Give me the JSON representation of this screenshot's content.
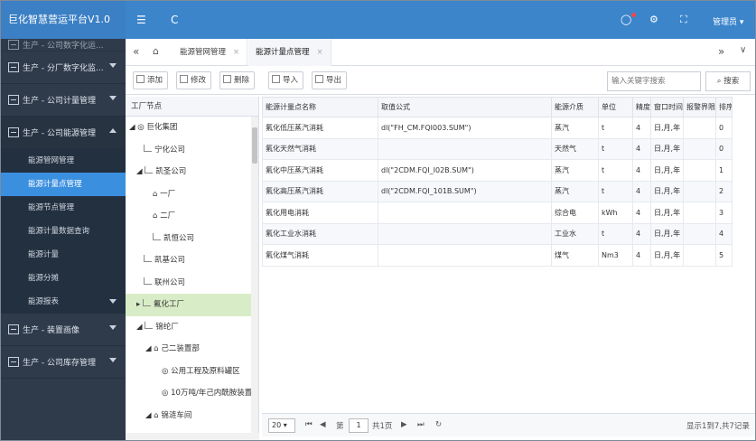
{
  "app": {
    "title": "巨化智慧营运平台V1.0"
  },
  "nav": {
    "items": [
      {
        "label": "生产 - 公司数字化运..."
      },
      {
        "label": "生产 - 分厂数字化监..."
      },
      {
        "label": "生产 - 公司计量管理"
      },
      {
        "label": "生产 - 公司能源管理"
      },
      {
        "label": "生产 - 装置画像"
      },
      {
        "label": "生产 - 公司库存管理"
      }
    ],
    "sub_items": [
      {
        "label": "能源管网管理"
      },
      {
        "label": "能源计量点管理"
      },
      {
        "label": "能源节点管理"
      },
      {
        "label": "能源计量数据查询"
      },
      {
        "label": "能源计量"
      },
      {
        "label": "能源分摊"
      },
      {
        "label": "能源报表"
      }
    ]
  },
  "topbar": {
    "menu_icon": "☰",
    "refresh_icon": "C",
    "user_label": "管理员 ▾"
  },
  "tabs": [
    {
      "label": "能源管网管理"
    },
    {
      "label": "能源计量点管理"
    }
  ],
  "toolbar": {
    "add": "添加",
    "edit": "修改",
    "delete": "删除",
    "import": "导入",
    "export": "导出",
    "search_placeholder": "输入关键字搜索",
    "search": "搜索"
  },
  "tree": {
    "header": "工厂节点",
    "nodes": [
      {
        "label": "巨化集团",
        "prefix": "◢ ◎ "
      },
      {
        "label": "宁化公司",
        "prefix": ""
      },
      {
        "label": "凯圣公司",
        "prefix": "◢ "
      },
      {
        "label": "一厂",
        "prefix": "⌂ "
      },
      {
        "label": "二厂",
        "prefix": "⌂ "
      },
      {
        "label": "凯恒公司",
        "prefix": ""
      },
      {
        "label": "凯基公司",
        "prefix": ""
      },
      {
        "label": "联州公司",
        "prefix": ""
      },
      {
        "label": "氟化工厂",
        "prefix": "▸ "
      },
      {
        "label": "锦纶厂",
        "prefix": "◢ "
      },
      {
        "label": "己二装置部",
        "prefix": "◢ ⌂ "
      },
      {
        "label": "公用工程及原料罐区",
        "prefix": "◎ "
      },
      {
        "label": "10万吨/年己内酰胺装置",
        "prefix": "◎ "
      },
      {
        "label": "锦涟车间",
        "prefix": "◢ ⌂ "
      }
    ]
  },
  "grid": {
    "columns": [
      "能源计量点名称",
      "取值公式",
      "能源介质",
      "单位",
      "精度",
      "窗口时间",
      "报警界限",
      "排序"
    ],
    "rows": [
      [
        "氟化低压蒸汽消耗",
        "dl(\"FH_CM.FQI003.SUM\")",
        "蒸汽",
        "t",
        "4",
        "日,月,年",
        "",
        "0"
      ],
      [
        "氟化天然气消耗",
        "",
        "天然气",
        "t",
        "4",
        "日,月,年",
        "",
        "0"
      ],
      [
        "氟化中压蒸汽消耗",
        "dl(\"2CDM.FQI_I02B.SUM\")",
        "蒸汽",
        "t",
        "4",
        "日,月,年",
        "",
        "1"
      ],
      [
        "氟化高压蒸汽消耗",
        "dl(\"2CDM.FQI_101B.SUM\")",
        "蒸汽",
        "t",
        "4",
        "日,月,年",
        "",
        "2"
      ],
      [
        "氟化用电消耗",
        "",
        "综合电",
        "kWh",
        "4",
        "日,月,年",
        "",
        "3"
      ],
      [
        "氟化工业水消耗",
        "",
        "工业水",
        "t",
        "4",
        "日,月,年",
        "",
        "4"
      ],
      [
        "氟化煤气消耗",
        "",
        "煤气",
        "Nm3",
        "4",
        "日,月,年",
        "",
        "5"
      ]
    ]
  },
  "pager": {
    "size": "20 ▾",
    "page_prefix": "第",
    "page": "1",
    "page_total": "共1页",
    "summary": "显示1到7,共7记录"
  }
}
